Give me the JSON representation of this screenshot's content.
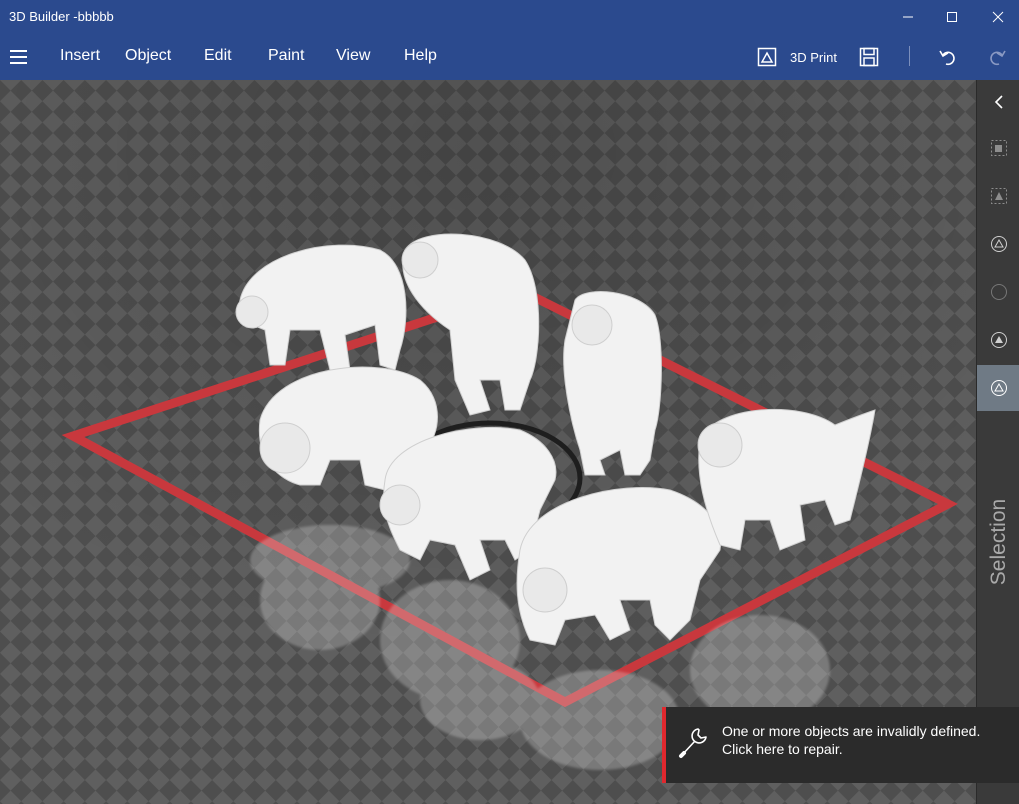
{
  "window": {
    "title": "3D Builder -bbbbb"
  },
  "menu": {
    "items": [
      "Insert",
      "Object",
      "Edit",
      "Paint",
      "View",
      "Help"
    ]
  },
  "toolbar": {
    "print_label": "3D Print",
    "icons": [
      "3d-print-icon",
      "save-icon",
      "undo-icon",
      "redo-icon"
    ]
  },
  "side_panel": {
    "label": "Selection",
    "icons": [
      "collapse-chevron-icon",
      "select-objects-icon",
      "select-faces-icon",
      "select-triangles-icon",
      "select-none-icon",
      "select-invert-icon",
      "select-mode-icon"
    ]
  },
  "notification": {
    "line1": "One or more objects are invalidly defined.",
    "line2": "Click here to repair.",
    "accent": "#e0282e"
  },
  "colors": {
    "titlebar": "#2b4a8e",
    "platform_outline": "#e0282e",
    "grid_dark": "#4f4f4f",
    "grid_light": "#666666"
  }
}
